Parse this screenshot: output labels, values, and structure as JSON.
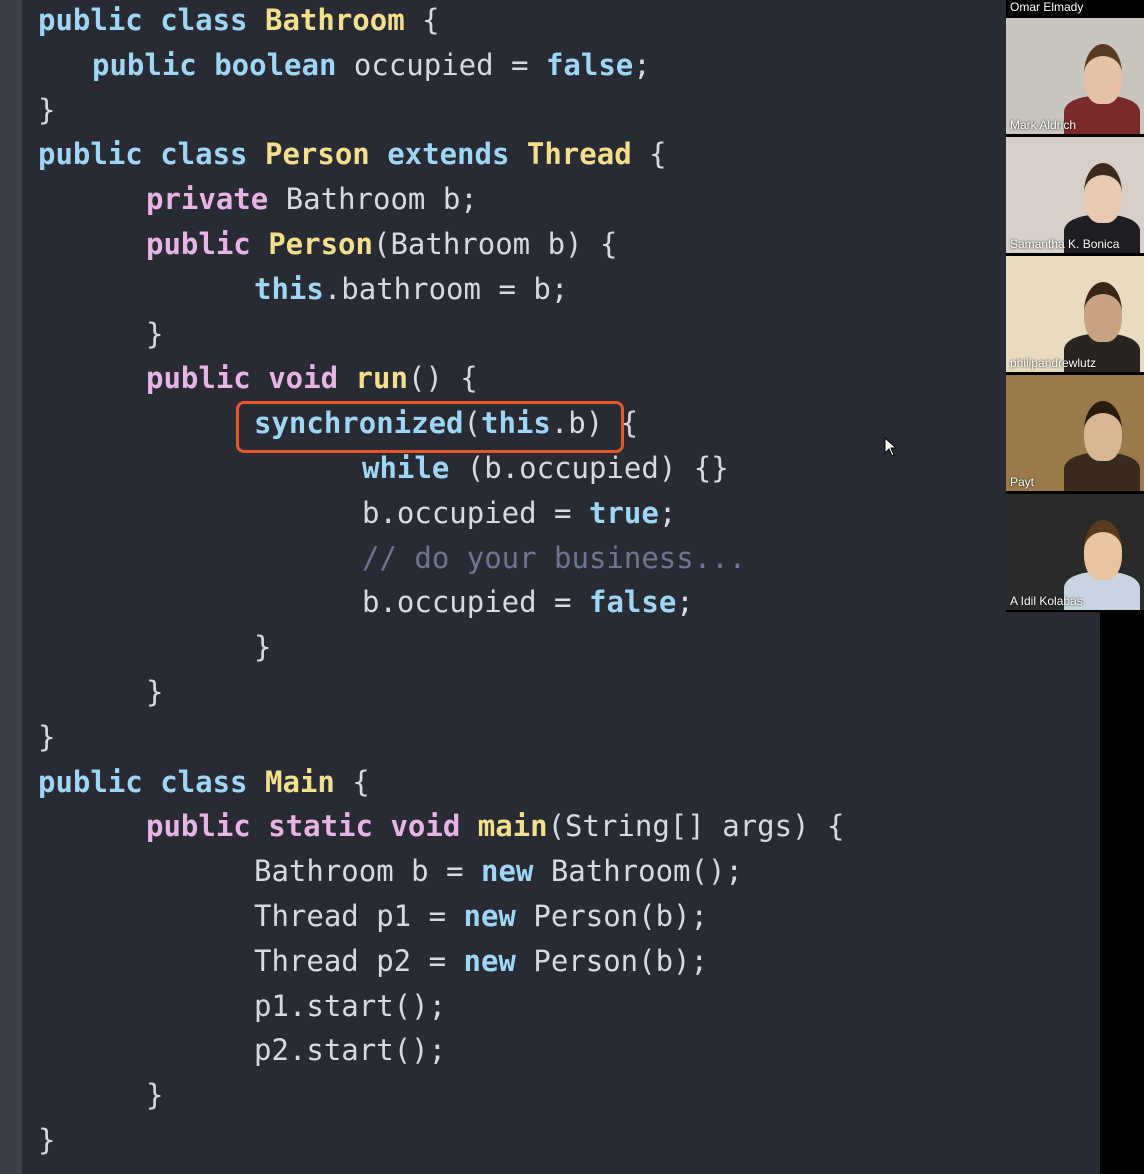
{
  "code": {
    "lines": [
      {
        "indent": 0,
        "tokens": [
          {
            "t": "public ",
            "c": "kw"
          },
          {
            "t": "class ",
            "c": "kw"
          },
          {
            "t": "Bathroom",
            "c": "type"
          },
          {
            "t": " {",
            "c": "punc"
          }
        ]
      },
      {
        "indent": 1,
        "tokens": [
          {
            "t": "public ",
            "c": "kw"
          },
          {
            "t": "boolean ",
            "c": "kw"
          },
          {
            "t": "occupied = ",
            "c": "plain"
          },
          {
            "t": "false",
            "c": "lit"
          },
          {
            "t": ";",
            "c": "punc"
          }
        ]
      },
      {
        "indent": 0,
        "tokens": [
          {
            "t": "}",
            "c": "punc"
          }
        ]
      },
      {
        "indent": 0,
        "tokens": [
          {
            "t": "public ",
            "c": "kw"
          },
          {
            "t": "class ",
            "c": "kw"
          },
          {
            "t": "Person ",
            "c": "type"
          },
          {
            "t": "extends ",
            "c": "kw"
          },
          {
            "t": "Thread",
            "c": "type"
          },
          {
            "t": " {",
            "c": "punc"
          }
        ]
      },
      {
        "indent": 2,
        "tokens": [
          {
            "t": "private ",
            "c": "kw2"
          },
          {
            "t": "Bathroom b;",
            "c": "plain"
          }
        ]
      },
      {
        "indent": 2,
        "tokens": [
          {
            "t": "public ",
            "c": "kw2"
          },
          {
            "t": "Person",
            "c": "fn"
          },
          {
            "t": "(Bathroom b) {",
            "c": "plain"
          }
        ]
      },
      {
        "indent": 4,
        "tokens": [
          {
            "t": "this",
            "c": "lit"
          },
          {
            "t": ".bathroom = b;",
            "c": "plain"
          }
        ]
      },
      {
        "indent": 2,
        "tokens": [
          {
            "t": "}",
            "c": "punc"
          }
        ]
      },
      {
        "indent": 2,
        "tokens": [
          {
            "t": "public ",
            "c": "kw2"
          },
          {
            "t": "void ",
            "c": "kw2"
          },
          {
            "t": "run",
            "c": "fn"
          },
          {
            "t": "() {",
            "c": "plain"
          }
        ]
      },
      {
        "indent": 4,
        "tokens": [
          {
            "t": "synchronized",
            "c": "lit"
          },
          {
            "t": "(",
            "c": "plain"
          },
          {
            "t": "this",
            "c": "lit"
          },
          {
            "t": ".b) {",
            "c": "plain"
          }
        ]
      },
      {
        "indent": 6,
        "tokens": [
          {
            "t": "while ",
            "c": "lit"
          },
          {
            "t": "(b.occupied) {}",
            "c": "plain"
          }
        ]
      },
      {
        "indent": 6,
        "tokens": [
          {
            "t": "b.occupied = ",
            "c": "plain"
          },
          {
            "t": "true",
            "c": "lit"
          },
          {
            "t": ";",
            "c": "punc"
          }
        ]
      },
      {
        "indent": 6,
        "tokens": [
          {
            "t": "// do your business...",
            "c": "comment"
          }
        ]
      },
      {
        "indent": 6,
        "tokens": [
          {
            "t": "b.occupied = ",
            "c": "plain"
          },
          {
            "t": "false",
            "c": "lit"
          },
          {
            "t": ";",
            "c": "punc"
          }
        ]
      },
      {
        "indent": 4,
        "tokens": [
          {
            "t": "}",
            "c": "punc"
          }
        ]
      },
      {
        "indent": 2,
        "tokens": [
          {
            "t": "}",
            "c": "punc"
          }
        ]
      },
      {
        "indent": 0,
        "tokens": [
          {
            "t": "}",
            "c": "punc"
          }
        ]
      },
      {
        "indent": 0,
        "tokens": [
          {
            "t": "public ",
            "c": "kw"
          },
          {
            "t": "class ",
            "c": "kw"
          },
          {
            "t": "Main",
            "c": "type"
          },
          {
            "t": " {",
            "c": "punc"
          }
        ]
      },
      {
        "indent": 2,
        "tokens": [
          {
            "t": "public ",
            "c": "kw2"
          },
          {
            "t": "static ",
            "c": "kw2"
          },
          {
            "t": "void ",
            "c": "kw2"
          },
          {
            "t": "main",
            "c": "fn"
          },
          {
            "t": "(String[] args) {",
            "c": "plain"
          }
        ]
      },
      {
        "indent": 4,
        "tokens": [
          {
            "t": "Bathroom b = ",
            "c": "plain"
          },
          {
            "t": "new ",
            "c": "lit"
          },
          {
            "t": "Bathroom();",
            "c": "plain"
          }
        ]
      },
      {
        "indent": 4,
        "tokens": [
          {
            "t": "Thread p1 = ",
            "c": "plain"
          },
          {
            "t": "new ",
            "c": "lit"
          },
          {
            "t": "Person(b);",
            "c": "plain"
          }
        ]
      },
      {
        "indent": 4,
        "tokens": [
          {
            "t": "Thread p2 = ",
            "c": "plain"
          },
          {
            "t": "new ",
            "c": "lit"
          },
          {
            "t": "Person(b);",
            "c": "plain"
          }
        ]
      },
      {
        "indent": 4,
        "tokens": [
          {
            "t": "p1.start();",
            "c": "plain"
          }
        ]
      },
      {
        "indent": 4,
        "tokens": [
          {
            "t": "p2.start();",
            "c": "plain"
          }
        ]
      },
      {
        "indent": 2,
        "tokens": [
          {
            "t": "}",
            "c": "punc"
          }
        ]
      },
      {
        "indent": 0,
        "tokens": [
          {
            "t": "}",
            "c": "punc"
          }
        ]
      }
    ]
  },
  "participants": {
    "top_label": "Omar Elmady",
    "tiles": [
      {
        "name": "Mark Aldrich",
        "bg": "#c9c6c0",
        "skin": "#e6c2a8",
        "hair": "#5a3a22",
        "shirt": "#7a2a2a"
      },
      {
        "name": "Samantha K. Bonica",
        "bg": "#d6d0c8",
        "skin": "#e8c9b2",
        "hair": "#3a2a20",
        "shirt": "#1e1e22"
      },
      {
        "name": "philipandrewlutz",
        "bg": "#e8dcc0",
        "skin": "#c9a484",
        "hair": "#3a2418",
        "shirt": "#2a2420"
      },
      {
        "name": "Payt",
        "bg": "#9a7a4a",
        "skin": "#d8b894",
        "hair": "#2a1a10",
        "shirt": "#3a2a1e"
      },
      {
        "name": "A Idil Kolabas",
        "bg": "#2a2a28",
        "skin": "#e8c4a0",
        "hair": "#5a3a1e",
        "shirt": "#c8d4e0"
      }
    ]
  },
  "colors": {
    "highlight_box": "#e8552b",
    "code_background": "#282b33"
  }
}
